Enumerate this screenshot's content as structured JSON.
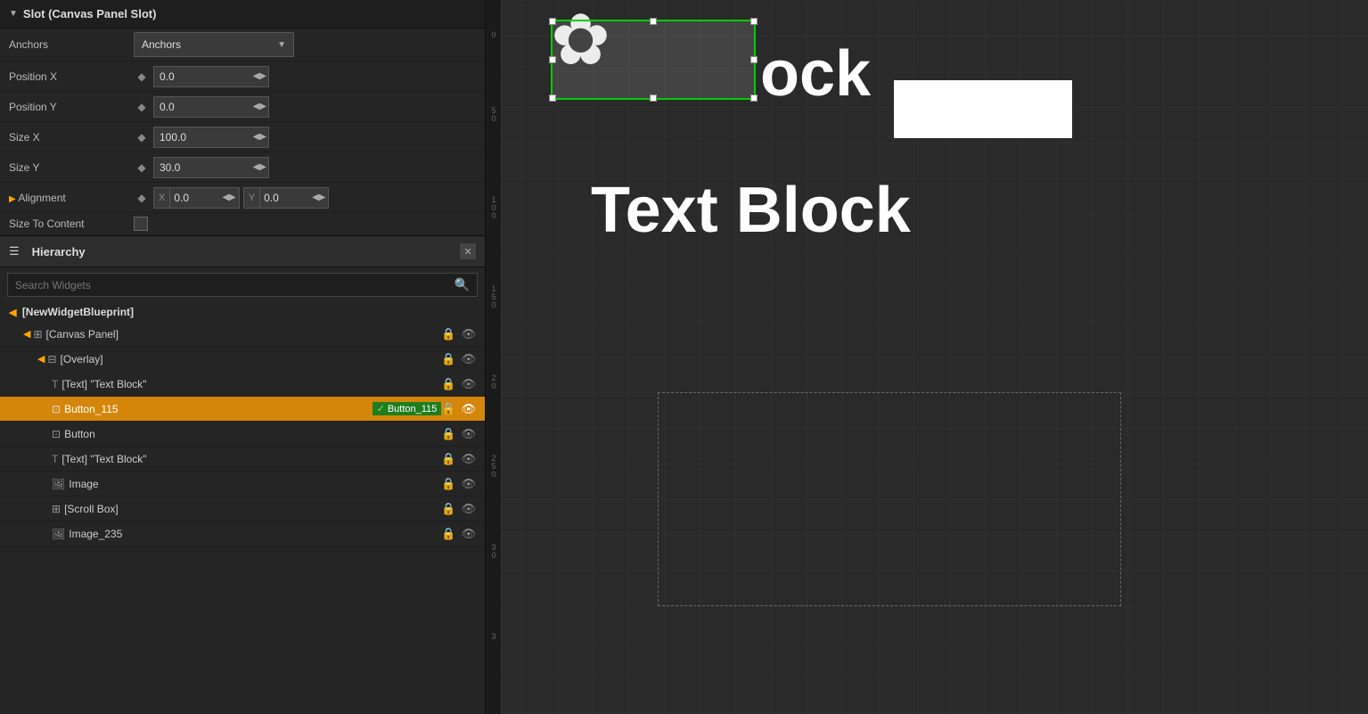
{
  "panel": {
    "title": "Slot (Canvas Panel Slot)",
    "properties": {
      "anchors_label": "Anchors",
      "anchors_value": "Anchors",
      "position_x_label": "Position X",
      "position_x_value": "0.0",
      "position_y_label": "Position Y",
      "position_y_value": "0.0",
      "size_x_label": "Size X",
      "size_x_value": "100.0",
      "size_y_label": "Size Y",
      "size_y_value": "30.0",
      "alignment_label": "Alignment",
      "alignment_x_label": "X",
      "alignment_x_value": "0.0",
      "alignment_y_label": "Y",
      "alignment_y_value": "0.0",
      "size_to_content_label": "Size To Content"
    }
  },
  "hierarchy": {
    "title": "Hierarchy",
    "search_placeholder": "Search Widgets",
    "root_item": "[NewWidgetBlueprint]",
    "items": [
      {
        "indent": 1,
        "icon": "panel",
        "label": "[Canvas Panel]",
        "depth": 1
      },
      {
        "indent": 2,
        "icon": "overlay",
        "label": "[Overlay]",
        "depth": 2
      },
      {
        "indent": 3,
        "icon": "text",
        "label": "[Text] \"Text Block\"",
        "depth": 3
      },
      {
        "indent": 3,
        "icon": "button",
        "label": "Button_115",
        "rename": "Button_115",
        "selected": true,
        "depth": 3
      },
      {
        "indent": 3,
        "icon": "panel",
        "label": "Button",
        "depth": 3
      },
      {
        "indent": 3,
        "icon": "text",
        "label": "[Text] \"Text Block\"",
        "depth": 3
      },
      {
        "indent": 3,
        "icon": "image",
        "label": "Image",
        "depth": 3
      },
      {
        "indent": 3,
        "icon": "scroll",
        "label": "[Scroll Box]",
        "depth": 3
      },
      {
        "indent": 3,
        "icon": "image",
        "label": "Image_235",
        "depth": 3
      }
    ]
  },
  "canvas": {
    "text_block_label": "Text Block",
    "ruler_marks": [
      "0",
      "5",
      "0",
      "1",
      "0",
      "0",
      "1",
      "5",
      "0",
      "2",
      "0",
      "2",
      "5",
      "0",
      "3",
      "0",
      "3"
    ]
  }
}
